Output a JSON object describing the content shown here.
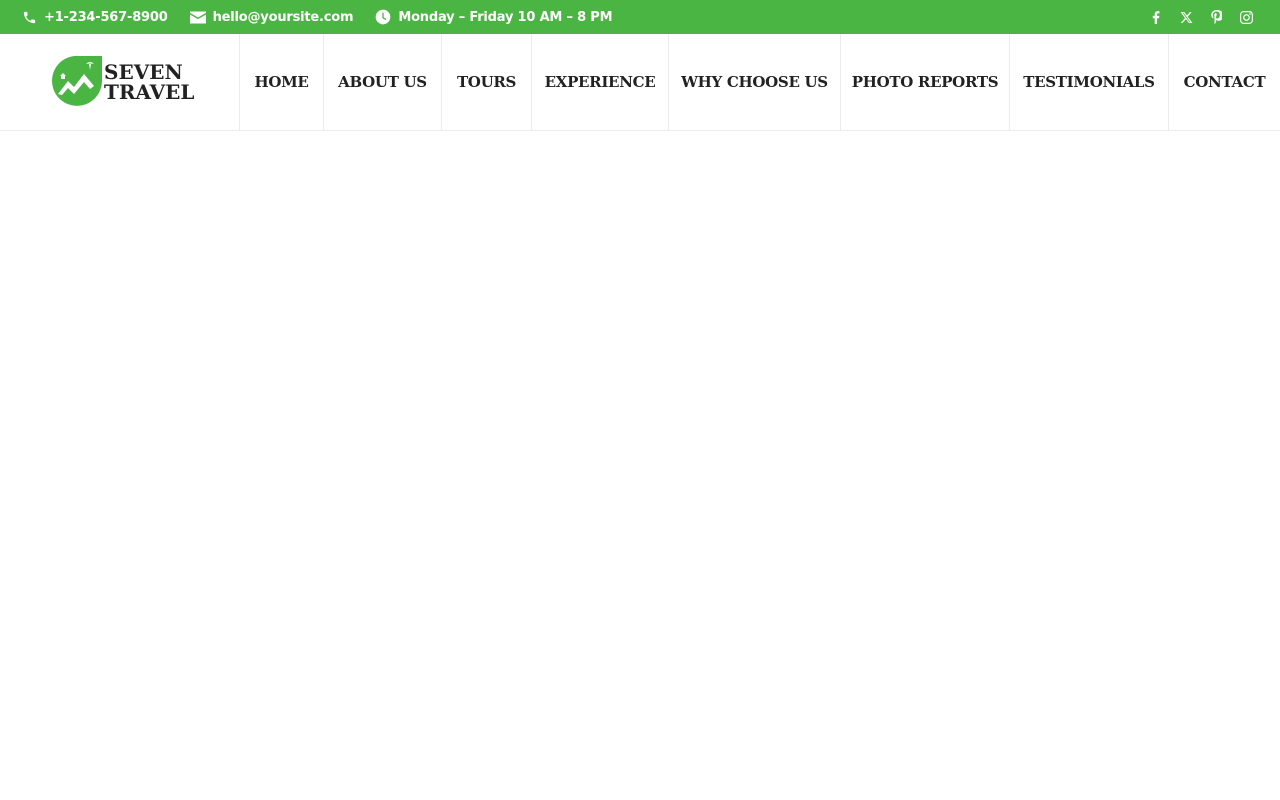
{
  "topbar": {
    "background_color": "#4bb543",
    "phone": {
      "icon": "phone-icon",
      "text": "+1-234-567-8900"
    },
    "email": {
      "icon": "envelope-icon",
      "text": "hello@yoursite.com"
    },
    "hours": {
      "icon": "clock-icon",
      "text": "Monday – Friday 10 AM – 8 PM"
    },
    "social": [
      {
        "icon": "facebook-icon"
      },
      {
        "icon": "x-twitter-icon"
      },
      {
        "icon": "pinterest-icon"
      },
      {
        "icon": "instagram-icon"
      }
    ]
  },
  "header": {
    "logo": {
      "line1": "SEVEN",
      "line2": "TRAVEL",
      "icon": "mountain-logo-icon",
      "accent_color": "#4bb543"
    },
    "nav": [
      {
        "label": "HOME"
      },
      {
        "label": "ABOUT US"
      },
      {
        "label": "TOURS"
      },
      {
        "label": "EXPERIENCE"
      },
      {
        "label": "WHY CHOOSE US"
      },
      {
        "label": "PHOTO REPORTS"
      },
      {
        "label": "TESTIMONIALS"
      },
      {
        "label": "CONTACT"
      }
    ]
  }
}
